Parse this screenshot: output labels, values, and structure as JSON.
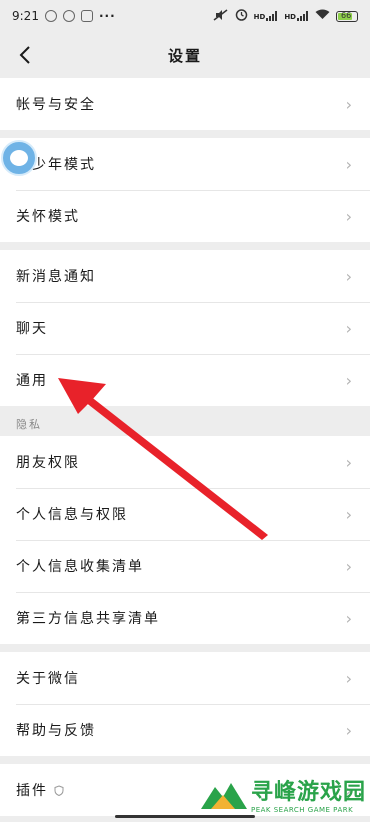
{
  "status_bar": {
    "time": "9:21",
    "dots": "···",
    "signal_labels": [
      "HD",
      "HD"
    ],
    "battery": "66"
  },
  "nav": {
    "title": "设置",
    "back_icon": "chevron-left-icon"
  },
  "groups": [
    {
      "items": [
        {
          "label": "帐号与安全"
        }
      ]
    },
    {
      "items": [
        {
          "label": "青少年模式"
        },
        {
          "label": "关怀模式"
        }
      ]
    },
    {
      "items": [
        {
          "label": "新消息通知"
        },
        {
          "label": "聊天"
        },
        {
          "label": "通用"
        }
      ]
    }
  ],
  "privacy": {
    "section_label": "隐私",
    "items": [
      {
        "label": "朋友权限"
      },
      {
        "label": "个人信息与权限"
      },
      {
        "label": "个人信息收集清单"
      },
      {
        "label": "第三方信息共享清单"
      }
    ]
  },
  "about_group": {
    "items": [
      {
        "label": "关于微信"
      },
      {
        "label": "帮助与反馈"
      }
    ]
  },
  "plugin_group": {
    "items": [
      {
        "label": "插件"
      }
    ]
  },
  "chevron": "›",
  "floating_bubble_text": "",
  "watermark": {
    "title": "寻峰游戏园",
    "subtitle": "PEAK SEARCH GAME PARK"
  },
  "colors": {
    "background": "#ededed",
    "arrow": "#e8222a",
    "watermark": "#2aa34a",
    "bubble": "#6fb3e6"
  }
}
